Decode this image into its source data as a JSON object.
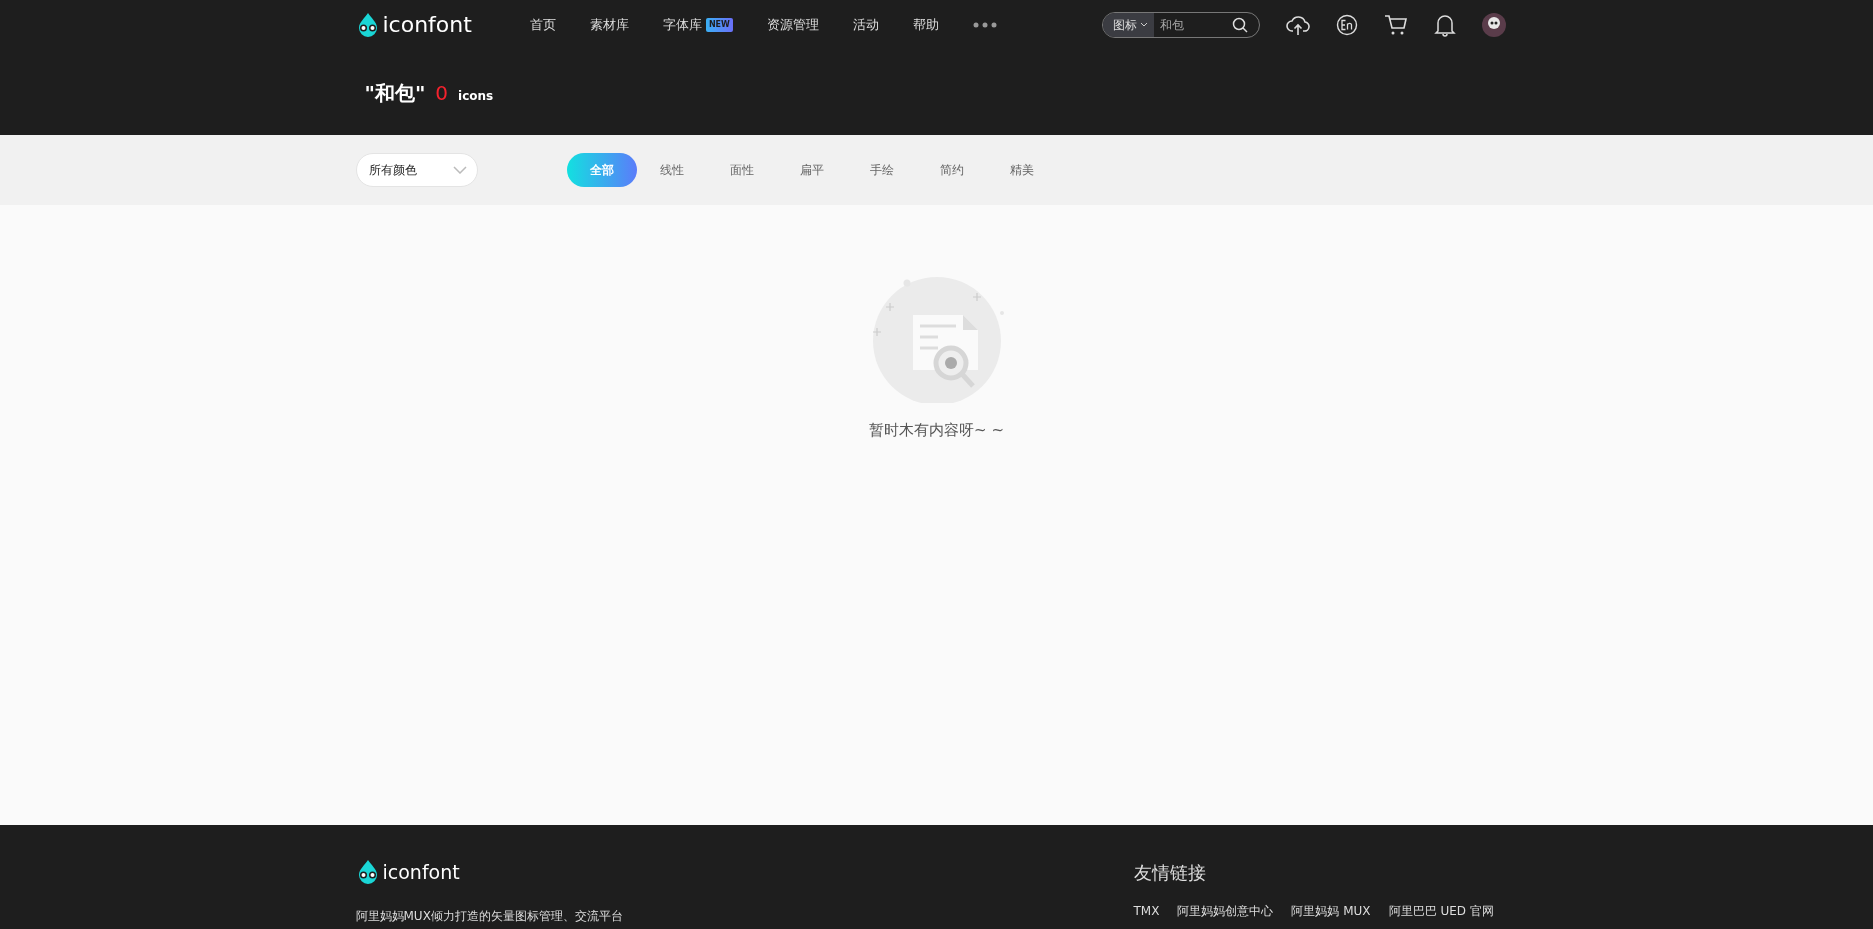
{
  "header": {
    "logo": "iconfont",
    "nav": [
      {
        "label": "首页"
      },
      {
        "label": "素材库"
      },
      {
        "label": "字体库",
        "badge": "NEW"
      },
      {
        "label": "资源管理"
      },
      {
        "label": "活动"
      },
      {
        "label": "帮助"
      }
    ],
    "search": {
      "scope": "图标",
      "value": "和包"
    }
  },
  "result": {
    "query": "\"和包\"",
    "count": "0",
    "unit": "icons"
  },
  "filters": {
    "color_select": "所有颜色",
    "styles": [
      {
        "label": "全部",
        "selected": true
      },
      {
        "label": "线性",
        "selected": false
      },
      {
        "label": "面性",
        "selected": false
      },
      {
        "label": "扁平",
        "selected": false
      },
      {
        "label": "手绘",
        "selected": false
      },
      {
        "label": "简约",
        "selected": false
      },
      {
        "label": "精美",
        "selected": false
      }
    ]
  },
  "empty": {
    "message": "暂时木有内容呀~ ~"
  },
  "footer": {
    "logo": "iconfont",
    "description": "阿里妈妈MUX倾力打造的矢量图标管理、交流平台",
    "links_title": "友情链接",
    "links": [
      "TMX",
      "阿里妈妈创意中心",
      "阿里妈妈 MUX",
      "阿里巴巴 UED 官网"
    ]
  }
}
